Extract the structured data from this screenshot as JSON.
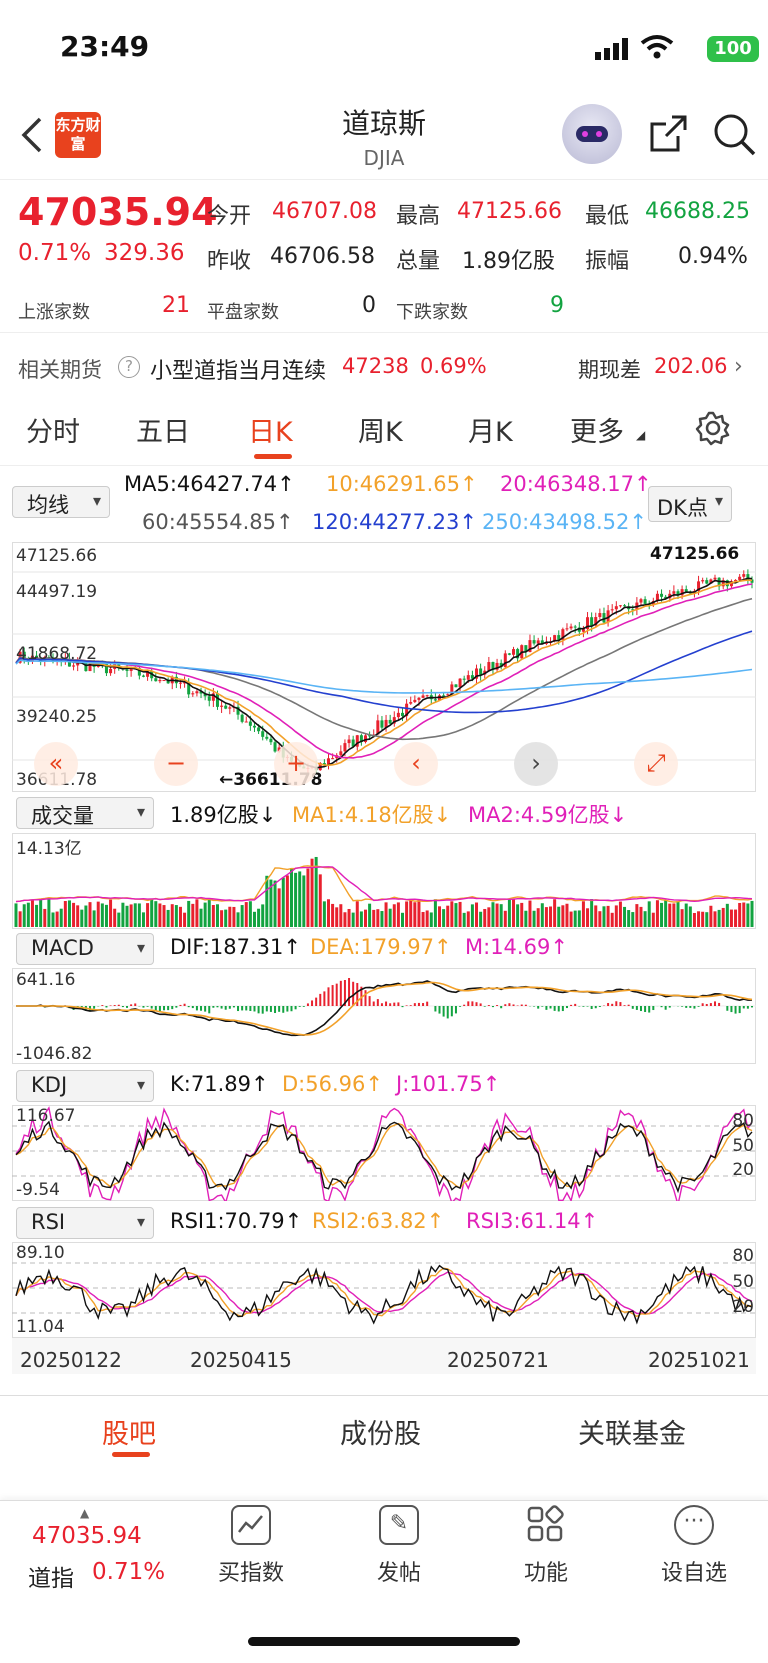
{
  "status": {
    "time": "23:49",
    "battery": "100"
  },
  "header": {
    "title": "道琼斯",
    "subtitle": "DJIA",
    "logo_text": "东方财富",
    "back_icon": "chevron-left-icon",
    "share_icon": "share-icon",
    "search_icon": "search-icon"
  },
  "quote": {
    "price": "47035.94",
    "pct": "0.71%",
    "chg": "329.36",
    "open_lbl": "今开",
    "open": "46707.08",
    "high_lbl": "最高",
    "high": "47125.66",
    "low_lbl": "最低",
    "low": "46688.25",
    "prev_lbl": "昨收",
    "prev": "46706.58",
    "vol_lbl": "总量",
    "vol": "1.89亿股",
    "amp_lbl": "振幅",
    "amp": "0.94%",
    "up_lbl": "上涨家数",
    "up": "21",
    "flat_lbl": "平盘家数",
    "flat": "0",
    "down_lbl": "下跌家数",
    "down": "9"
  },
  "futures": {
    "label": "相关期货",
    "name": "小型道指当月连续",
    "price": "47238",
    "pct": "0.69%",
    "basis_lbl": "期现差",
    "basis": "202.06"
  },
  "tabs": [
    "分时",
    "五日",
    "日K",
    "周K",
    "月K",
    "更多"
  ],
  "active_tab": "日K",
  "ma": {
    "selector": "均线",
    "ma5": "MA5:46427.74↑",
    "ma10": "10:46291.65↑",
    "ma20": "20:46348.17↑",
    "ma60": "60:45554.85↑",
    "ma120": "120:44277.23↑",
    "ma250": "250:43498.52↑",
    "dk": "DK点"
  },
  "kline": {
    "y_labels": [
      "47125.66",
      "44497.19",
      "41868.72",
      "39240.25",
      "36611.78"
    ],
    "max_marker": "47125.66",
    "min_marker": "←36611.78"
  },
  "volume": {
    "selector": "成交量",
    "value": "1.89亿股↓",
    "ma1": "MA1:4.18亿股↓",
    "ma2": "MA2:4.59亿股↓",
    "ymax": "14.13亿"
  },
  "macd": {
    "selector": "MACD",
    "dif": "DIF:187.31↑",
    "dea": "DEA:179.97↑",
    "m": "M:14.69↑",
    "ymax": "641.16",
    "ymin": "-1046.82"
  },
  "kdj": {
    "selector": "KDJ",
    "k": "K:71.89↑",
    "d": "D:56.96↑",
    "j": "J:101.75↑",
    "ymax": "116.67",
    "ymin": "-9.54",
    "levels": [
      "80",
      "50",
      "20"
    ]
  },
  "rsi": {
    "selector": "RSI",
    "rsi1": "RSI1:70.79↑",
    "rsi2": "RSI2:63.82↑",
    "rsi3": "RSI3:61.14↑",
    "ymax": "89.10",
    "ymin": "11.04",
    "levels": [
      "80",
      "50",
      "20"
    ]
  },
  "dates": [
    "20250122",
    "20250415",
    "20250721",
    "20251021"
  ],
  "bottom_tabs": [
    "股吧",
    "成份股",
    "关联基金"
  ],
  "bottom_nav": {
    "price": "47035.94",
    "name": "道指",
    "pct": "0.71%",
    "items": [
      "买指数",
      "发帖",
      "功能",
      "设自选"
    ]
  },
  "colors": {
    "up": "#e8212e",
    "down": "#12a340",
    "accent": "#e8421e",
    "ma5": "#111111",
    "ma10": "#f2a12a",
    "ma20": "#e020b8",
    "ma60": "#777777",
    "ma120": "#2440cf",
    "ma250": "#5ab4f5"
  }
}
